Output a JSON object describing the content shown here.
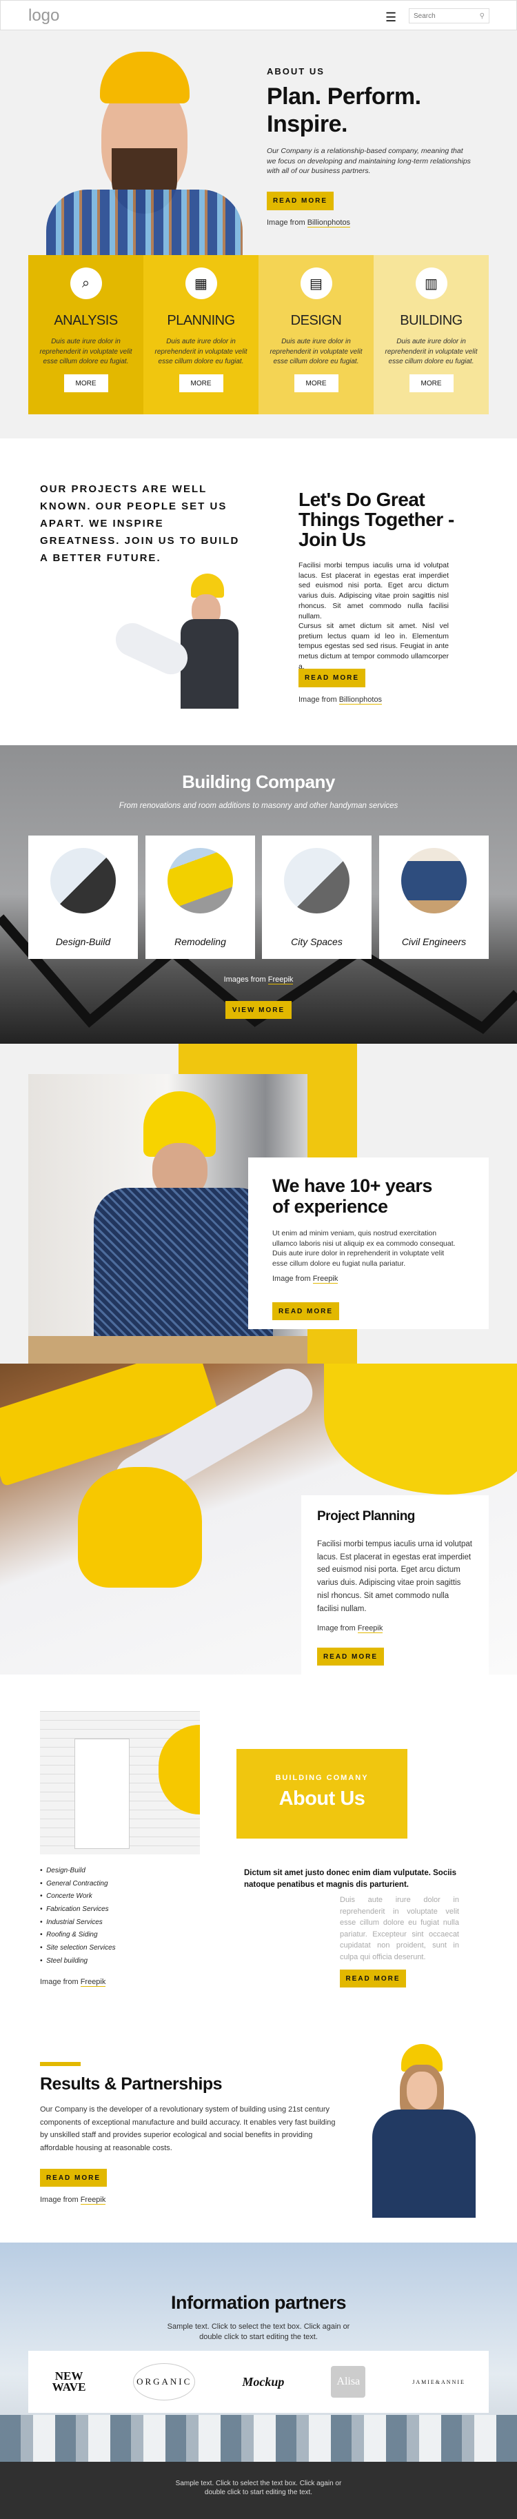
{
  "header": {
    "logo": "logo",
    "search_placeholder": "Search",
    "menu_icon": "hamburger-icon",
    "search_icon": "magnifier-icon"
  },
  "hero": {
    "eyebrow": "ABOUT US",
    "title_line1": "Plan. Perform.",
    "title_line2": "Inspire.",
    "text": "Our Company is a relationship-based company, meaning that we focus on developing and maintaining long-term relationships with all of our business partners.",
    "button": "READ MORE",
    "credit_prefix": "Image from ",
    "credit_link": "Billionphotos"
  },
  "features": [
    {
      "title": "ANALYSIS",
      "text": "Duis aute irure dolor in reprehenderit in voluptate velit esse cillum dolore eu fugiat.",
      "button": "MORE",
      "icon": "analysis-icon",
      "color": "#e3b800"
    },
    {
      "title": "PLANNING",
      "text": "Duis aute irure dolor in reprehenderit in voluptate velit esse cillum dolore eu fugiat.",
      "button": "MORE",
      "icon": "planning-board-icon",
      "color": "#f0c60f"
    },
    {
      "title": "DESIGN",
      "text": "Duis aute irure dolor in reprehenderit in voluptate velit esse cillum dolore eu fugiat.",
      "button": "MORE",
      "icon": "blueprint-icon",
      "color": "#f4d454"
    },
    {
      "title": "BUILDING",
      "text": "Duis aute irure dolor in reprehenderit in voluptate velit esse cillum dolore eu fugiat.",
      "button": "MORE",
      "icon": "buildings-icon",
      "color": "#f7e59a"
    }
  ],
  "join": {
    "statement": "OUR PROJECTS ARE WELL KNOWN. OUR PEOPLE SET US APART. WE INSPIRE GREATNESS. JOIN US TO BUILD A BETTER FUTURE.",
    "title": "Let's Do Great Things Together - Join Us",
    "p1": "Facilisi morbi tempus iaculis urna id volutpat lacus. Est placerat in egestas erat imperdiet sed euismod nisi porta. Eget arcu dictum varius duis. Adipiscing vitae proin sagittis nisl rhoncus. Sit amet commodo nulla facilisi nullam.",
    "p2": "Cursus sit amet dictum sit amet. Nisl vel pretium lectus quam id leo in. Elementum tempus egestas sed sed risus. Feugiat in ante metus dictum at tempor commodo ullamcorper a.",
    "button": "READ MORE",
    "credit_prefix": "Image from ",
    "credit_link": "Billionphotos"
  },
  "building": {
    "title": "Building Company",
    "subtitle": "From renovations and room additions to masonry and other handyman services",
    "services": [
      "Design-Build",
      "Remodeling",
      "City Spaces",
      "Civil Engineers"
    ],
    "credit_prefix": "Images from ",
    "credit_link": "Freepik",
    "button": "VIEW MORE"
  },
  "experience": {
    "title": "We have 10+ years of experience",
    "text": "Ut enim ad minim veniam, quis nostrud exercitation ullamco laboris nisi ut aliquip ex ea commodo consequat. Duis aute irure dolor in reprehenderit in voluptate velit esse cillum dolore eu fugiat nulla pariatur.",
    "credit_prefix": "Image from ",
    "credit_link": "Freepik",
    "button": "READ MORE"
  },
  "planning": {
    "title": "Project Planning",
    "text": "Facilisi morbi tempus iaculis urna id volutpat lacus. Est placerat in egestas erat imperdiet sed euismod nisi porta. Eget arcu dictum varius duis. Adipiscing vitae proin sagittis nisl rhoncus. Sit amet commodo nulla facilisi nullam.",
    "credit_prefix": "Image from ",
    "credit_link": "Freepik",
    "button": "READ MORE"
  },
  "about": {
    "eyebrow": "BUILDING COMANY",
    "title": "About Us",
    "list": [
      "Design-Build",
      "General Contracting",
      "Concerte Work",
      "Fabrication Services",
      "Industrial Services",
      "Roofing & Siding",
      "Site selection Services",
      "Steel building"
    ],
    "credit_prefix": "Image from ",
    "credit_link": "Freepik",
    "lead": "Dictum sit amet justo donec enim diam vulputate. Sociis natoque penatibus et magnis dis parturient.",
    "text": "Duis aute irure dolor in reprehenderit in voluptate velit esse cillum dolore eu fugiat nulla pariatur. Excepteur sint occaecat cupidatat non proident, sunt in culpa qui officia deserunt.",
    "button": "READ MORE"
  },
  "results": {
    "title": "Results & Partnerships",
    "text": "Our Company is the developer of a revolutionary system of building using 21st century components of exceptional manufacture and build accuracy. It enables very fast building by unskilled staff and provides superior ecological and social benefits in providing affordable housing at reasonable costs.",
    "button": "READ MORE",
    "credit_prefix": "Image from ",
    "credit_link": "Freepik"
  },
  "partners": {
    "title": "Information partners",
    "text": "Sample text. Click to select the text box. Click again or double click to start editing the text.",
    "logos": [
      "NEW WAVE",
      "ORGANIC",
      "Mockup",
      "Alisa",
      "JAMIE&ANNIE"
    ]
  },
  "footer": {
    "text": "Sample text. Click to select the text box. Click again or double click to start editing the text."
  },
  "colors": {
    "accent": "#e2b800",
    "footer": "#303030"
  }
}
